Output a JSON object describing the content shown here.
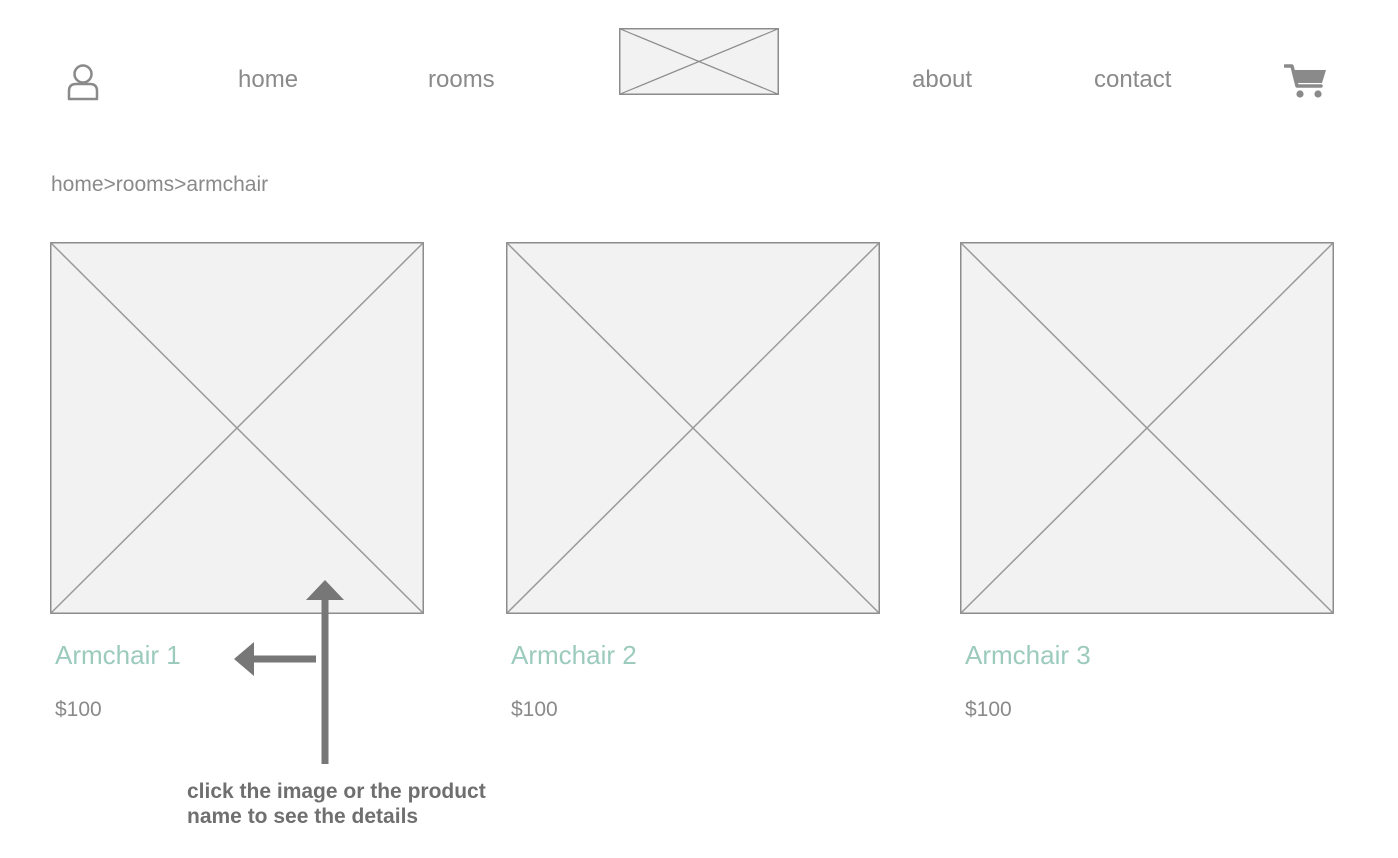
{
  "header": {
    "nav_left": [
      {
        "label": "home"
      },
      {
        "label": "rooms"
      }
    ],
    "nav_right": [
      {
        "label": "about"
      },
      {
        "label": "contact"
      }
    ],
    "icons": {
      "account": "user-icon",
      "logo": "logo-placeholder",
      "cart": "cart-icon"
    }
  },
  "breadcrumb": {
    "items": [
      "home",
      "rooms",
      "armchair"
    ],
    "separator": ">"
  },
  "products": [
    {
      "name": "Armchair 1",
      "price": "$100"
    },
    {
      "name": "Armchair 2",
      "price": "$100"
    },
    {
      "name": "Armchair 3",
      "price": "$100"
    }
  ],
  "annotation": {
    "text": "click the image or the product name to see the details"
  },
  "colors": {
    "accent": "#9ccbbd",
    "text": "#8a8a8a",
    "placeholder_fill": "#f2f2f2",
    "placeholder_stroke": "#8c8c8c",
    "annotation": "#777777"
  }
}
